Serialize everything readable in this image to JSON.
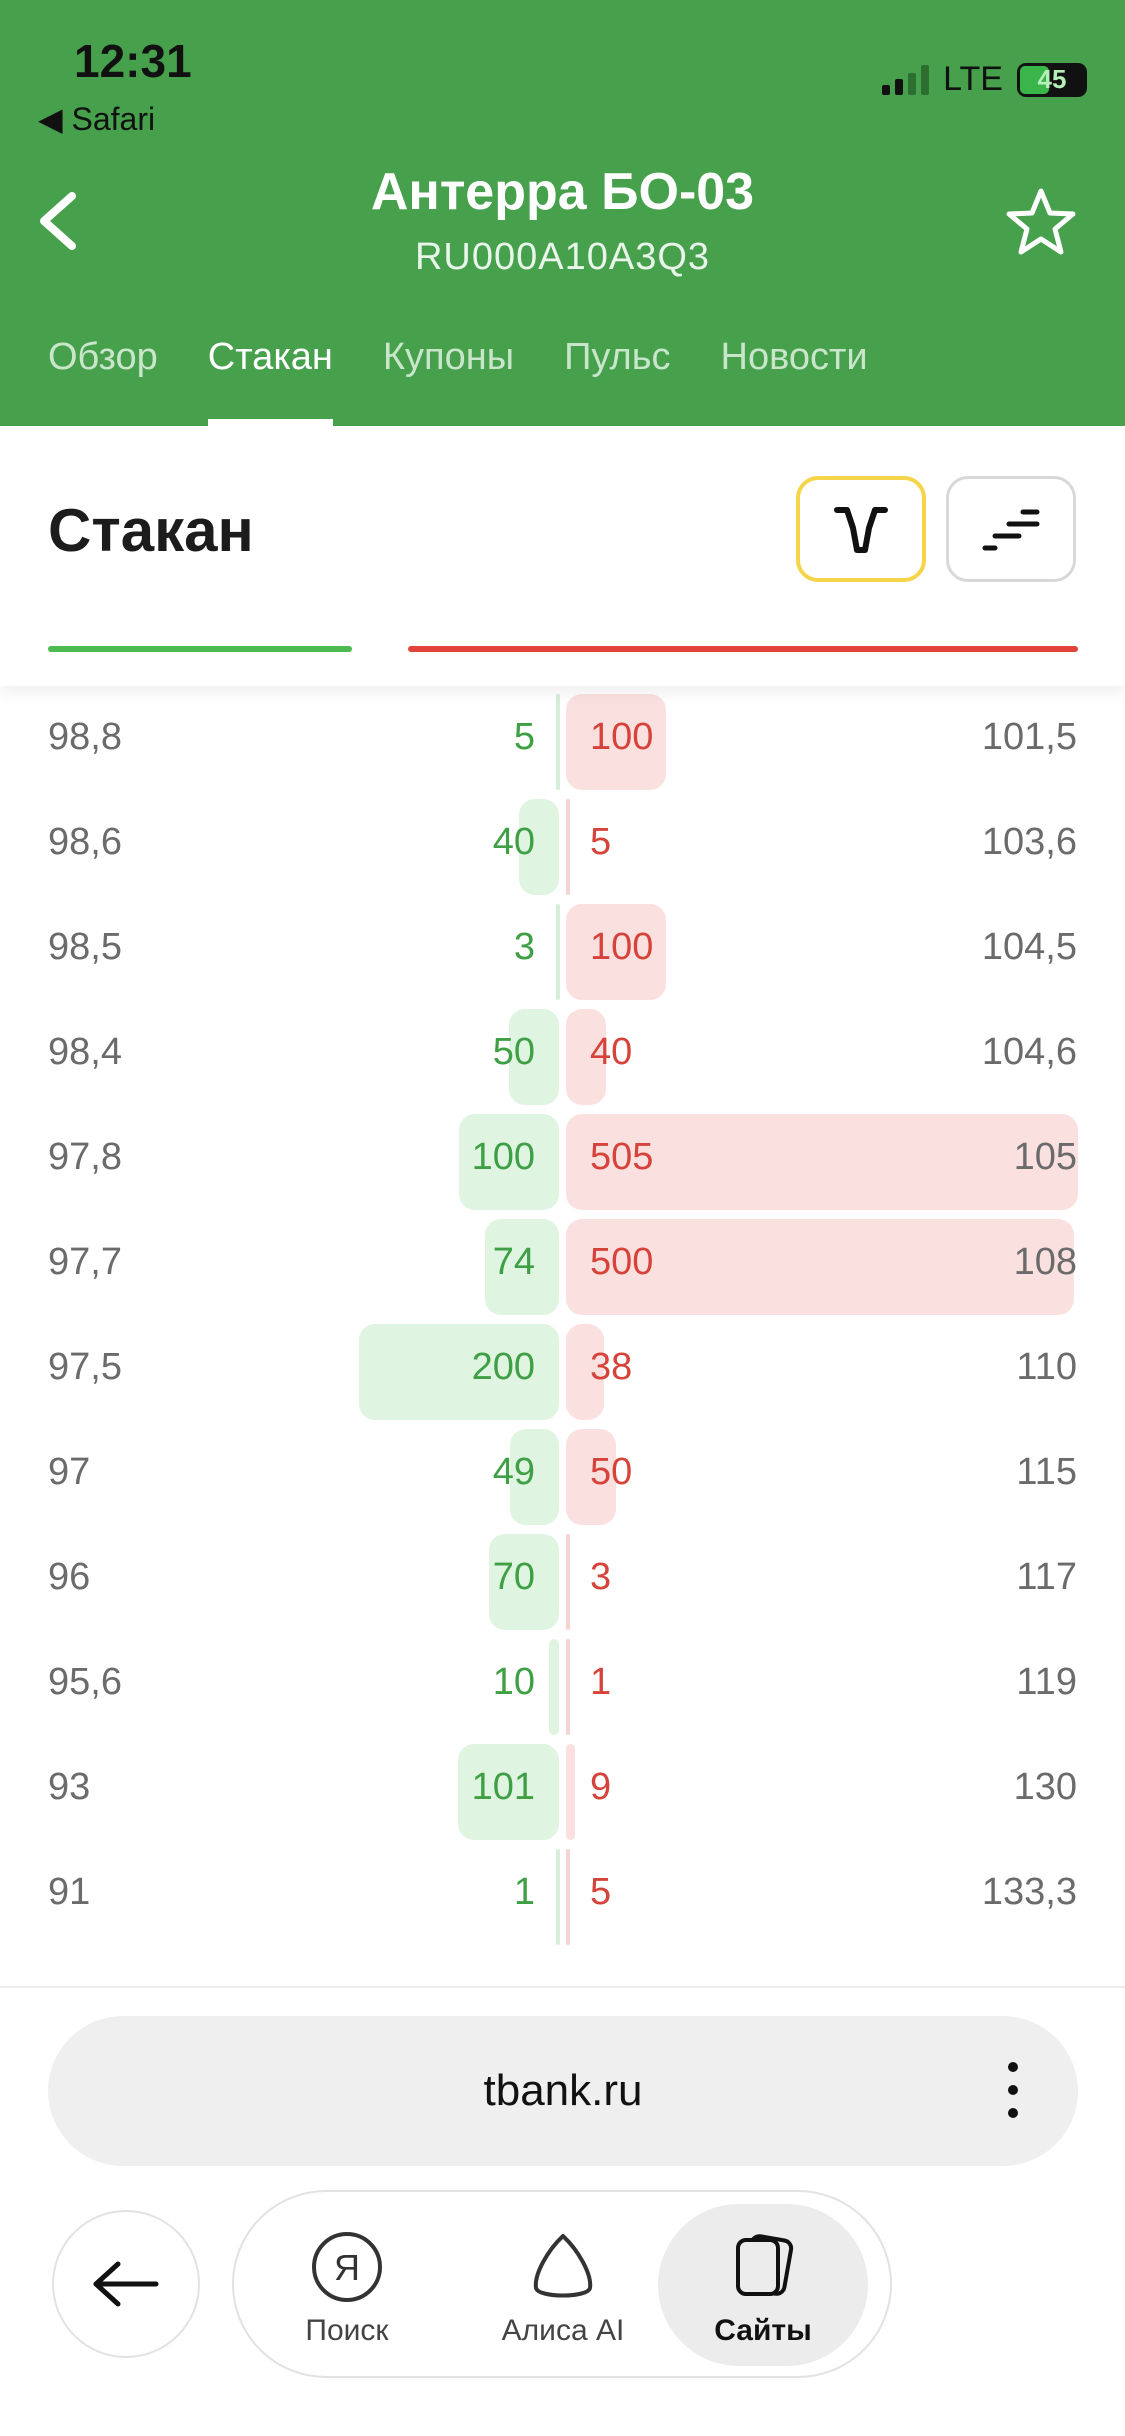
{
  "status_bar": {
    "time": "12:31",
    "back_app": "◀ Safari",
    "network": "LTE",
    "battery": "45"
  },
  "header": {
    "title": "Антерра БО-03",
    "subtitle": "RU000A10A3Q3",
    "tabs": [
      {
        "label": "Обзор",
        "active": false
      },
      {
        "label": "Стакан",
        "active": true
      },
      {
        "label": "Купоны",
        "active": false
      },
      {
        "label": "Пульс",
        "active": false
      },
      {
        "label": "Новости",
        "active": false
      }
    ]
  },
  "section": {
    "title": "Стакан"
  },
  "order_book": [
    {
      "bid_price": "98,8",
      "bid_qty": "5",
      "ask_qty": "100",
      "ask_price": "101,5"
    },
    {
      "bid_price": "98,6",
      "bid_qty": "40",
      "ask_qty": "5",
      "ask_price": "103,6"
    },
    {
      "bid_price": "98,5",
      "bid_qty": "3",
      "ask_qty": "100",
      "ask_price": "104,5"
    },
    {
      "bid_price": "98,4",
      "bid_qty": "50",
      "ask_qty": "40",
      "ask_price": "104,6"
    },
    {
      "bid_price": "97,8",
      "bid_qty": "100",
      "ask_qty": "505",
      "ask_price": "105"
    },
    {
      "bid_price": "97,7",
      "bid_qty": "74",
      "ask_qty": "500",
      "ask_price": "108"
    },
    {
      "bid_price": "97,5",
      "bid_qty": "200",
      "ask_qty": "38",
      "ask_price": "110"
    },
    {
      "bid_price": "97",
      "bid_qty": "49",
      "ask_qty": "50",
      "ask_price": "115"
    },
    {
      "bid_price": "96",
      "bid_qty": "70",
      "ask_qty": "3",
      "ask_price": "117"
    },
    {
      "bid_price": "95,6",
      "bid_qty": "10",
      "ask_qty": "1",
      "ask_price": "119"
    },
    {
      "bid_price": "93",
      "bid_qty": "101",
      "ask_qty": "9",
      "ask_price": "130"
    },
    {
      "bid_price": "91",
      "bid_qty": "1",
      "ask_qty": "5",
      "ask_price": "133,3"
    }
  ],
  "browser": {
    "url": "tbank.ru",
    "nav": [
      {
        "label": "Поиск",
        "active": false
      },
      {
        "label": "Алиса AI",
        "active": false
      },
      {
        "label": "Сайты",
        "active": true
      }
    ]
  },
  "colors": {
    "header_green": "#46a04c",
    "bid_green": "#3f9f45",
    "ask_red": "#d6433a",
    "active_mode_border": "#f5d44a"
  }
}
